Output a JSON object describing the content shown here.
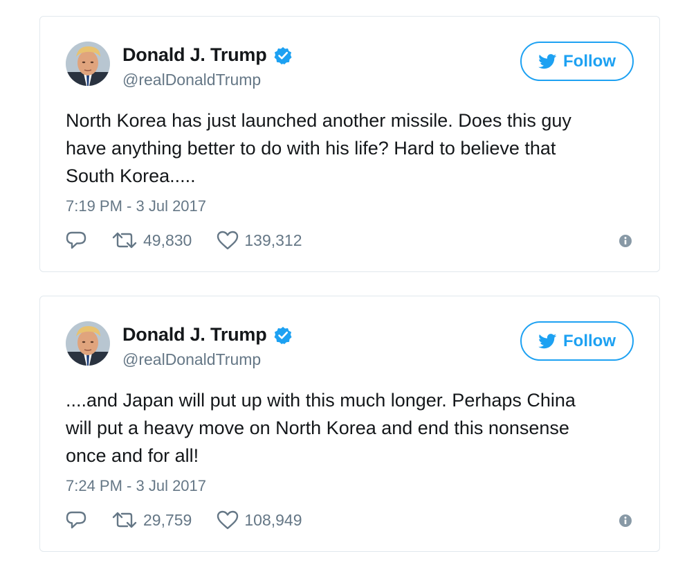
{
  "tweets": [
    {
      "author": {
        "display_name": "Donald J. Trump",
        "handle": "@realDonaldTrump",
        "verified": true
      },
      "follow_label": "Follow",
      "lines": [
        "North Korea has just launched another missile. Does this guy",
        "have anything better to do with his life? Hard to believe that",
        "South Korea....."
      ],
      "timestamp": "7:19 PM - 3 Jul 2017",
      "retweets": "49,830",
      "likes": "139,312"
    },
    {
      "author": {
        "display_name": "Donald J. Trump",
        "handle": "@realDonaldTrump",
        "verified": true
      },
      "follow_label": "Follow",
      "lines": [
        "....and Japan will put up with this much longer. Perhaps China",
        "will put a heavy move on North Korea and end this nonsense",
        "once and for all!"
      ],
      "timestamp": "7:24 PM - 3 Jul 2017",
      "retweets": "29,759",
      "likes": "108,949"
    }
  ],
  "icons": {
    "verified": "verified-badge-icon",
    "follow": "twitter-bird-icon",
    "reply": "reply-icon",
    "retweet": "retweet-icon",
    "like": "heart-icon",
    "info": "info-icon"
  },
  "colors": {
    "accent": "#1da1f2",
    "text": "#14171a",
    "secondary": "#657786",
    "border": "#e1e8ed"
  }
}
